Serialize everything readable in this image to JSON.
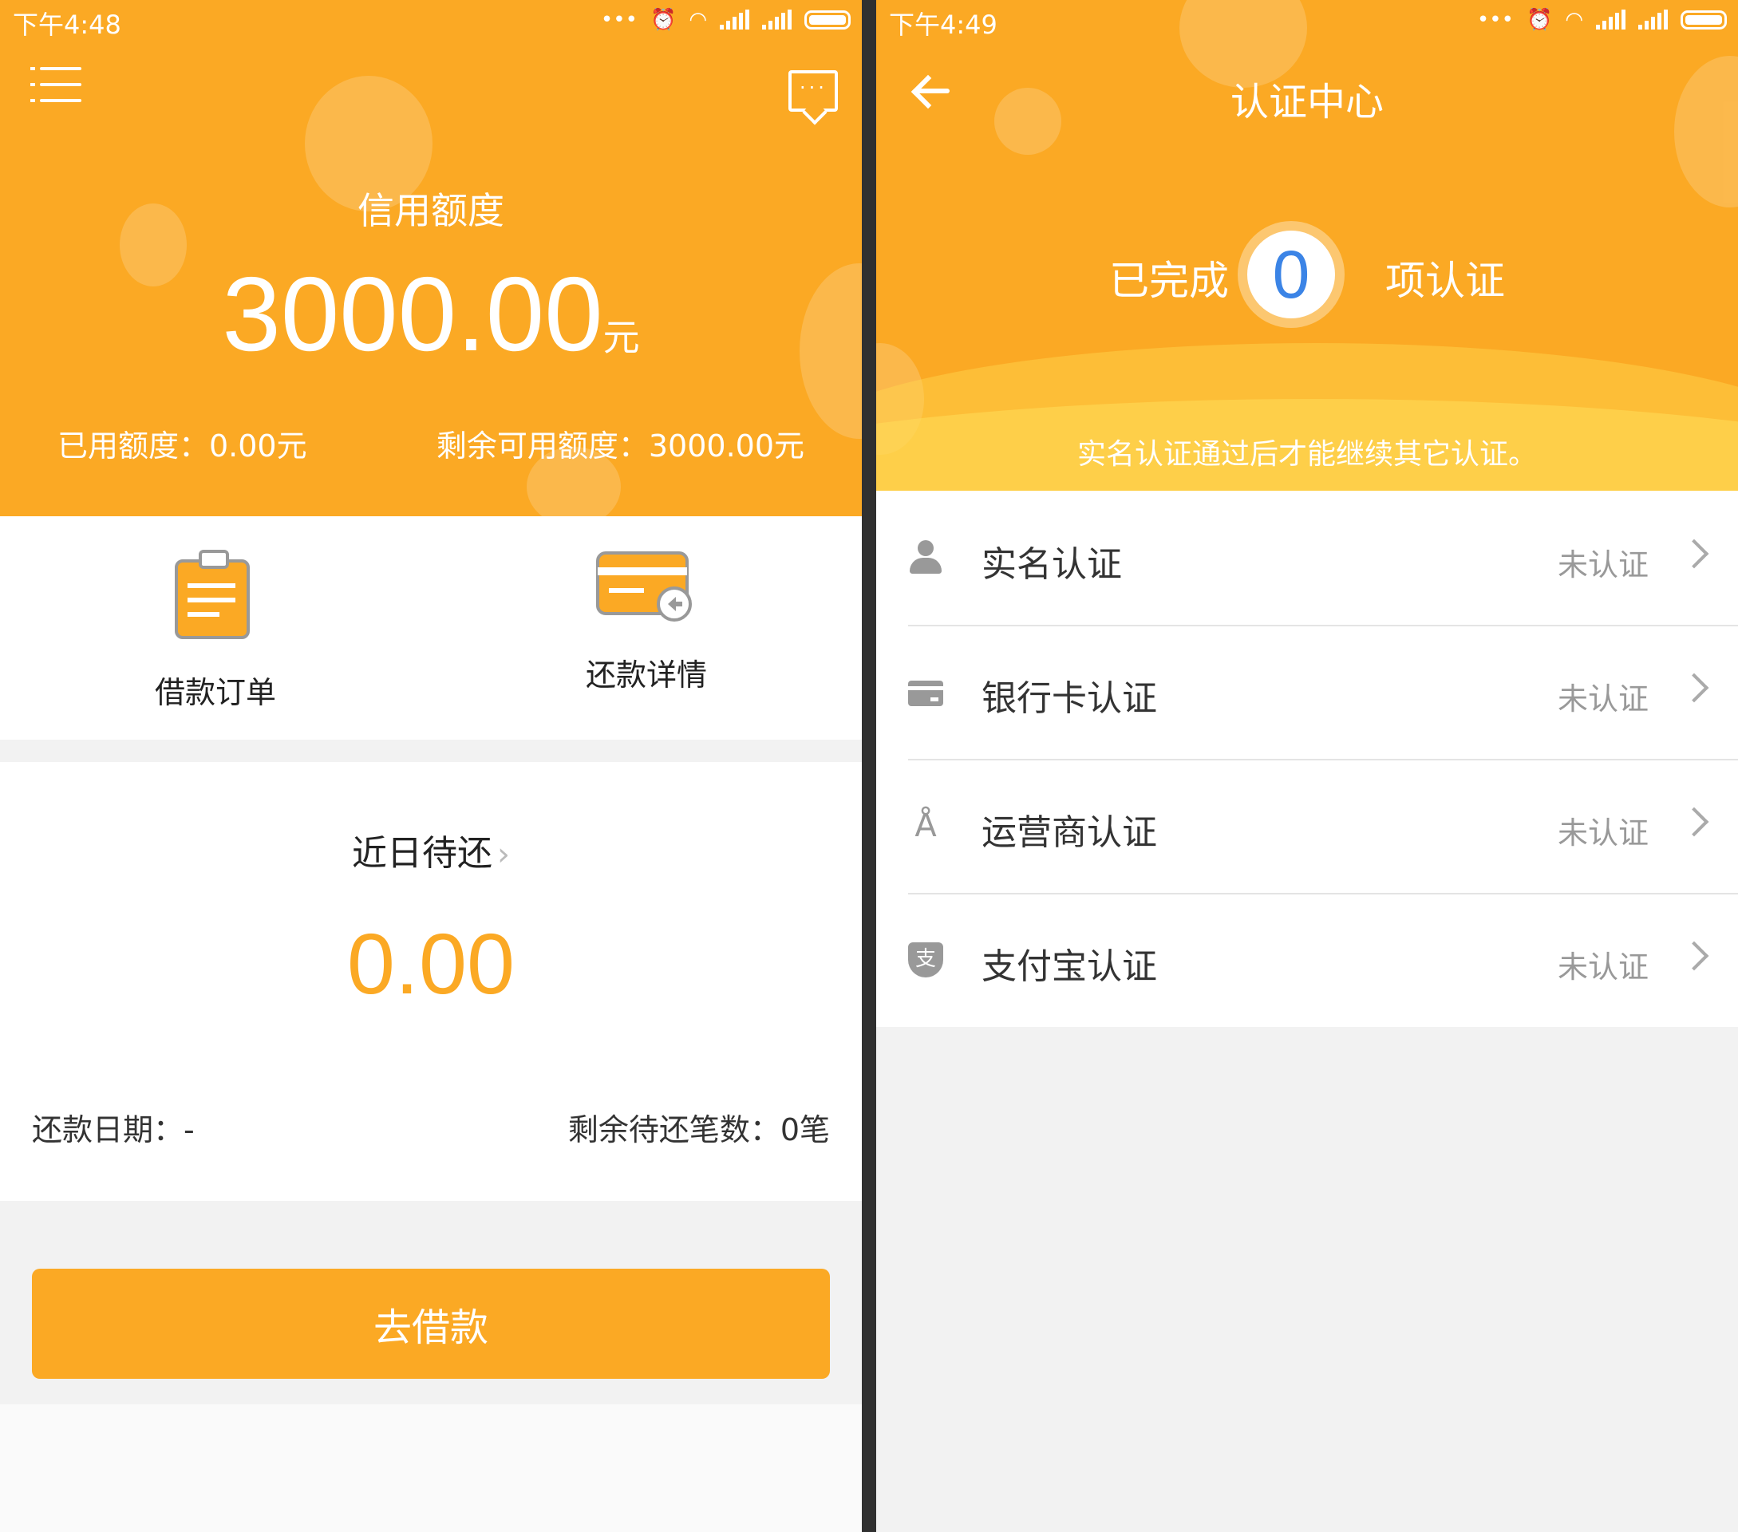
{
  "left": {
    "status_time": "下午4:48",
    "header": {
      "credit_label": "信用额度",
      "credit_amount": "3000.00",
      "credit_unit": "元",
      "used": "已用额度：0.00元",
      "remaining": "剩余可用额度：3000.00元"
    },
    "actions": [
      {
        "label": "借款订单",
        "icon": "clipboard-icon"
      },
      {
        "label": "还款详情",
        "icon": "card-return-icon"
      }
    ],
    "upcoming": {
      "title": "近日待还",
      "amount": "0.00",
      "date": "还款日期：-",
      "count": "剩余待还笔数：0笔"
    },
    "borrow_button": "去借款"
  },
  "right": {
    "status_time": "下午4:49",
    "title": "认证中心",
    "completed_prefix": "已完成",
    "completed_count": "0",
    "completed_suffix": "项认证",
    "notice": "实名认证通过后才能继续其它认证。",
    "items": [
      {
        "name": "实名认证",
        "status": "未认证",
        "icon": "person-icon"
      },
      {
        "name": "银行卡认证",
        "status": "未认证",
        "icon": "bank-card-icon"
      },
      {
        "name": "运营商认证",
        "status": "未认证",
        "icon": "signal-tower-icon"
      },
      {
        "name": "支付宝认证",
        "status": "未认证",
        "icon": "alipay-shield-icon"
      }
    ]
  },
  "colors": {
    "accent": "#fba924",
    "count_blue": "#3b84e6",
    "background": "#f2f2f2"
  }
}
